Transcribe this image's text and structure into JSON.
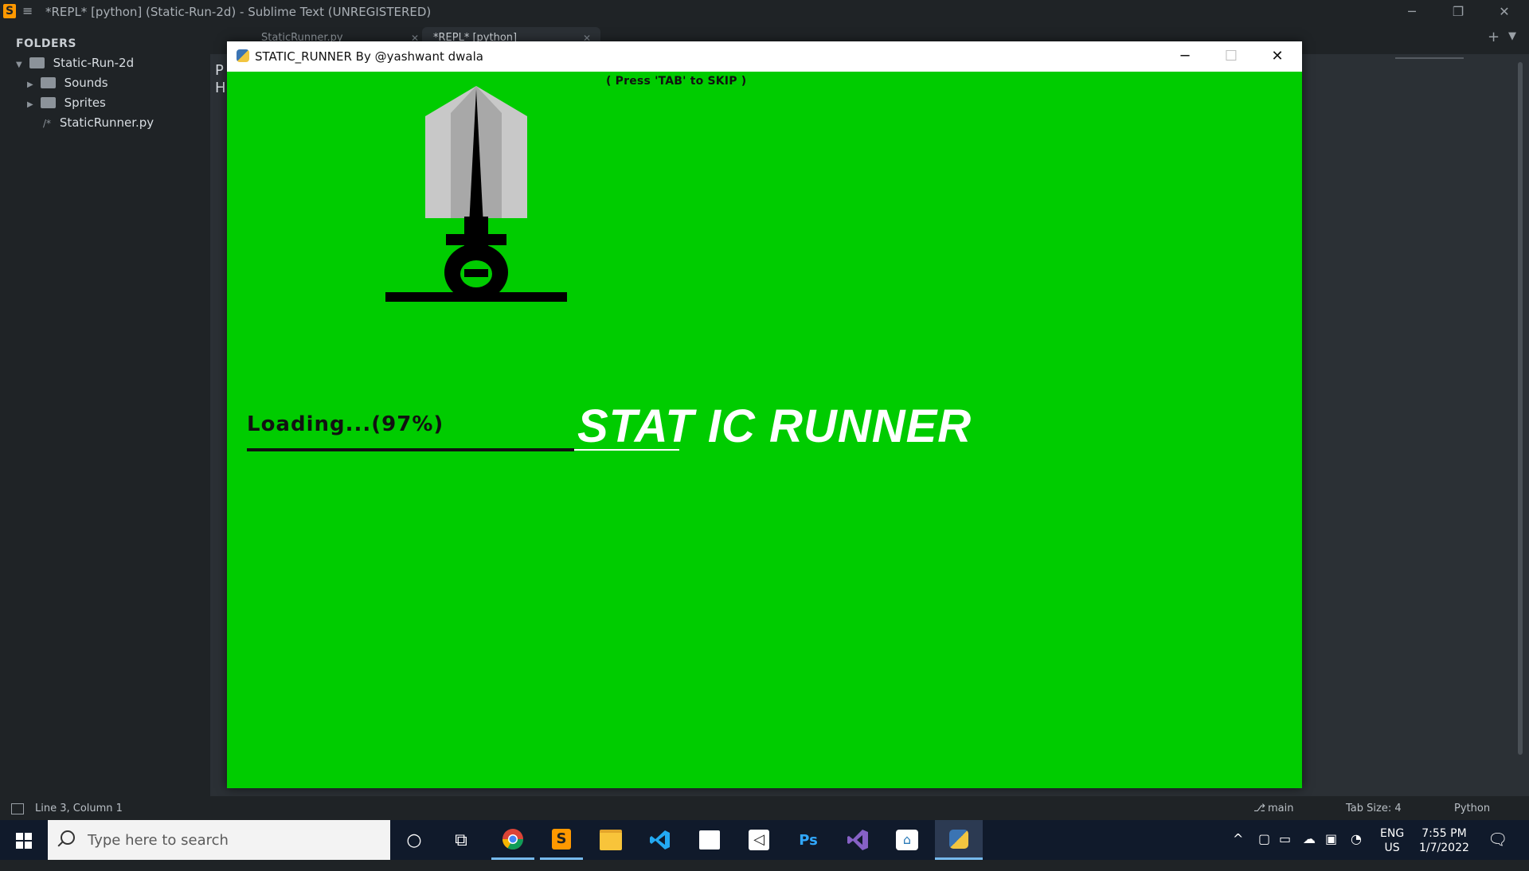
{
  "app": {
    "title": "*REPL* [python] (Static-Run-2d) - Sublime Text (UNREGISTERED)",
    "menu_icon": "hamburger-icon",
    "logo_icon": "sublime-logo-icon"
  },
  "sidebar": {
    "header": "FOLDERS",
    "root": "Static-Run-2d",
    "items": [
      {
        "label": "Sounds",
        "type": "folder"
      },
      {
        "label": "Sprites",
        "type": "folder"
      },
      {
        "label": "StaticRunner.py",
        "type": "file"
      }
    ]
  },
  "tabs": [
    {
      "label": "StaticRunner.py",
      "active": false
    },
    {
      "label": "*REPL* [python]",
      "active": true
    }
  ],
  "editor": {
    "fragment_line1": "P",
    "fragment_line2": "H"
  },
  "game_window": {
    "title": "STATIC_RUNNER By @yashwant dwala",
    "skip_hint": "( Press 'TAB' to SKIP )",
    "loading_label": "Loading...(97%)",
    "progress": 0.97,
    "game_title": "STAT IC RUNNER"
  },
  "statusbar": {
    "position": "Line 3, Column 1",
    "branch": "main",
    "tab_size": "Tab Size: 4",
    "syntax": "Python"
  },
  "taskbar": {
    "search_placeholder": "Type here to search",
    "apps": [
      "cortana-icon",
      "task-view-icon",
      "chrome-icon",
      "sublime-icon",
      "file-explorer-icon",
      "vscode-icon",
      "store-icon",
      "unity-icon",
      "photoshop-icon",
      "visual-studio-icon",
      "remote-icon",
      "python-icon"
    ],
    "photoshop_label": "Ps",
    "lang_line1": "ENG",
    "lang_line2": "US",
    "time": "7:55 PM",
    "date": "1/7/2022"
  },
  "colors": {
    "game_bg": "#00cc00",
    "sublime_bg": "#1f2326",
    "taskbar_bg": "#101a2b"
  }
}
